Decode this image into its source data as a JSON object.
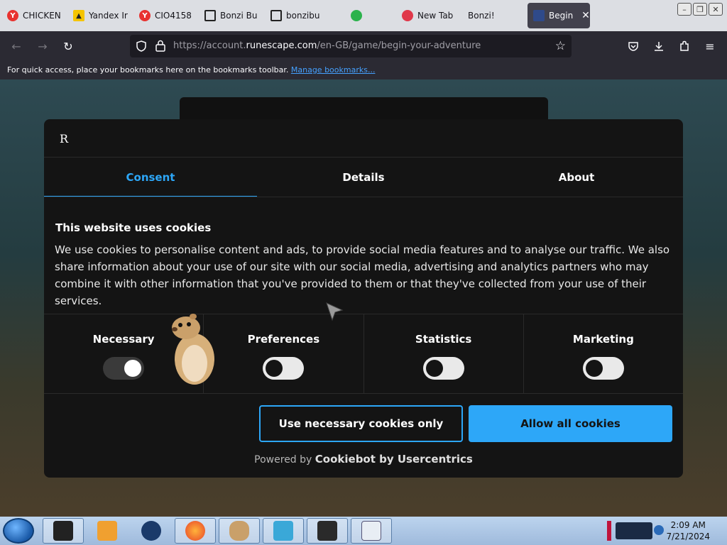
{
  "browser": {
    "tabs": [
      {
        "label": "CHICKEN",
        "icon": "yandex-icon"
      },
      {
        "label": "Yandex Ir",
        "icon": "yandex-images-icon"
      },
      {
        "label": "CIO4158",
        "icon": "yandex-icon"
      },
      {
        "label": "Bonzi Bu",
        "icon": "bank-icon"
      },
      {
        "label": "bonzibu",
        "icon": "bank-icon"
      },
      {
        "label": "New Tab",
        "icon": "firefox-icon"
      },
      {
        "label": "Bonzi!",
        "icon": ""
      },
      {
        "label": "Begin",
        "icon": "runescape-icon",
        "active": true
      }
    ],
    "url": {
      "prefix": "https://account.",
      "domain": "runescape.com",
      "path": "/en-GB/game/begin-your-adventure"
    },
    "bookmarks_text": "For quick access, place your bookmarks here on the bookmarks toolbar.",
    "bookmarks_link": "Manage bookmarks..."
  },
  "cookie_dialog": {
    "logo": "R",
    "tabs": [
      "Consent",
      "Details",
      "About"
    ],
    "active_tab": "Consent",
    "heading": "This website uses cookies",
    "body": "We use cookies to personalise content and ads, to provide social media features and to analyse our traffic. We also share information about your use of our site with our social media, advertising and analytics partners who may combine it with other information that you've provided to them or that they've collected from your use of their services.",
    "toggles": [
      {
        "label": "Necessary",
        "on": true
      },
      {
        "label": "Preferences",
        "on": false
      },
      {
        "label": "Statistics",
        "on": false
      },
      {
        "label": "Marketing",
        "on": false
      }
    ],
    "btn_necessary": "Use necessary cookies only",
    "btn_all": "Allow all cookies",
    "powered_prefix": "Powered by",
    "powered_brand": "Cookiebot by Usercentrics"
  },
  "colors": {
    "accent": "#2da7f8",
    "dialog_bg": "#141414"
  },
  "taskbar": {
    "time": "2:09 AM",
    "date": "7/21/2024"
  }
}
